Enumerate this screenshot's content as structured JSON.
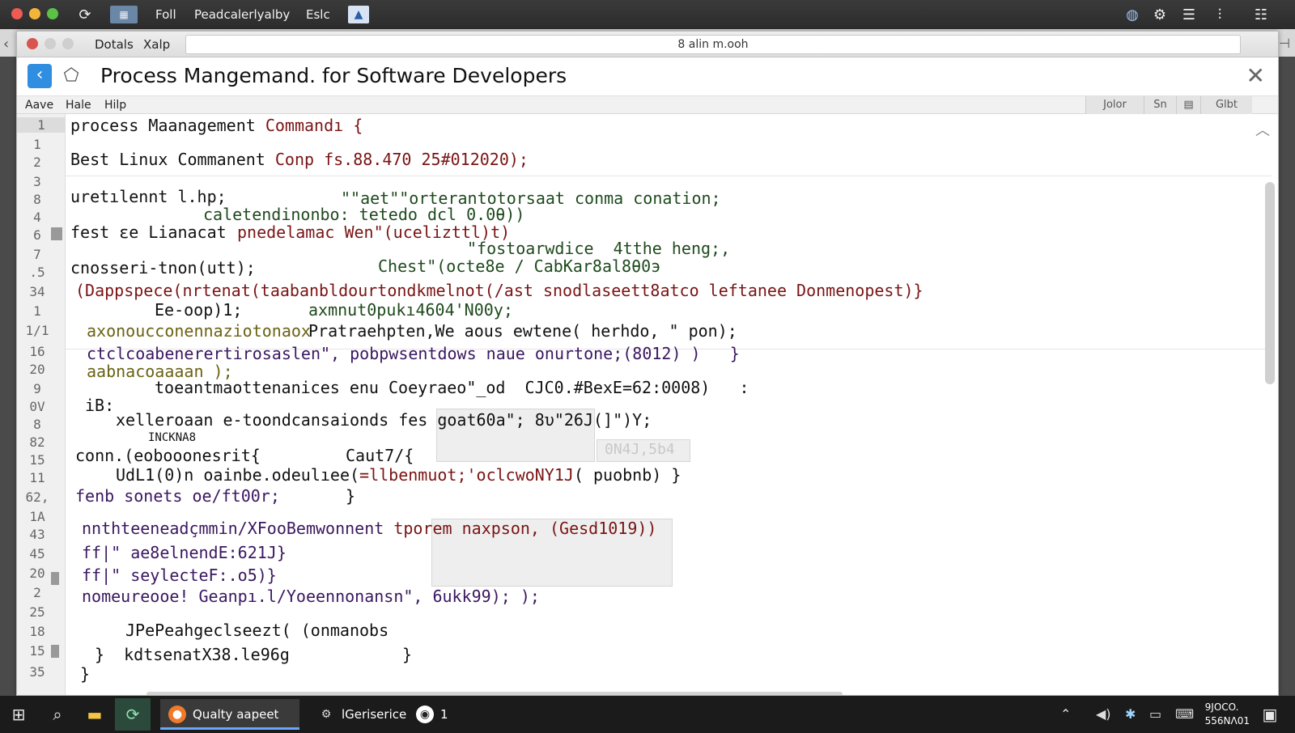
{
  "menubar": {
    "items": [
      "Foll",
      "Peadcalerlyalby",
      "Eslc"
    ]
  },
  "window": {
    "tabs": [
      "Dotals",
      "Xalp"
    ],
    "address": "8 alin m.ooh",
    "title": "Process Mangemand. for Software Developers"
  },
  "app_menu": {
    "items": [
      "Aave",
      "Hale",
      "Hilp"
    ],
    "tools": [
      "Jolor",
      "Sn",
      "Glbt"
    ]
  },
  "editor": {
    "line_numbers": [
      "1",
      "1",
      "2",
      "3",
      "8",
      "4",
      "6",
      "7",
      ".5",
      "34",
      "1",
      "1/1",
      "16",
      "20",
      "9",
      "0V",
      "8",
      "82",
      "15",
      "11",
      "62,",
      "1A",
      "43",
      "45",
      "20",
      "2",
      "25",
      "18",
      "15",
      "35"
    ],
    "lines": [
      {
        "text": "process Maanagement",
        "col2": "Commandı {"
      },
      {
        "text": "Best Linux Commanent",
        "col2": "Conp fs.88.470 25#012020);"
      },
      {
        "text": "uretılennt l.hp;",
        "col2": "\"\"aet\"\"orterantotorsaat conma conation;"
      },
      {
        "text": "caletendinonbo: tetedo dcl 0.0θ))"
      },
      {
        "text": "fest εe Lianacat",
        "col2": "pnedelamac Wen\"(ucelizttl)t)"
      },
      {
        "text": "\"fostoarwdice  4tthe heng;,"
      },
      {
        "text": "cnosseri-tnon(utt);",
        "col2": "Chest\"(octe8e / CabKar8al8θ0э"
      },
      {
        "text": "(Dappspece(nrtenat(taabanbldourtondkmelnot(/ast snodlaseett8atco leftanee Donmenopest)}"
      },
      {
        "text": "Ee-oop)1;",
        "col2": "axmnut0pukı4604'N00y;"
      },
      {
        "text": "axonoucconennaziotonaox",
        "col2": "Pratraehpten,We aous ewtene( herhdo, \" pon);"
      },
      {
        "text": "ctclcoabenerertirosaslen\", pobpwsentdows naue onurtone;(8012) )   }"
      },
      {
        "text": "aabnacoaaaan );"
      },
      {
        "text": "toeantmaottenanices enu Coeyraeo\"_od  CJC0.#BexE=62:0008)   :"
      },
      {
        "text": "iB:"
      },
      {
        "text": "xelleroaan e-toondcansaionds fes goat60a\"; 8υ\"26J(]\")Y;"
      },
      {
        "text": "INCKNA8"
      },
      {
        "text": "conn.(eobooonesrit{",
        "col2": "Caut7/{"
      },
      {
        "text": "UdL1(0)n oainbe.odeulıee(",
        "col2": "=llbenmuot;'oclcwoNY1J",
        "col3": "( puobnb) }"
      },
      {
        "text": "fenb sonets oe/ft00r;",
        "col2": "}"
      },
      {
        "text": "nnthteeneadçmmin/XFooBemwonnent",
        "col2": "tporem naxpson,",
        "col3": "(Gesd1019))"
      },
      {
        "text": "ff|\" ae8elnendE:621J}"
      },
      {
        "text": "ff|\" seylecteF:.o5)}"
      },
      {
        "text": "nomeureooe! Geanpı.l/Yoeennonansn\", 6ukk99); );"
      },
      {
        "text": "JPePeahgeclseezt( (onmanobs"
      },
      {
        "text": "}  kdtsenatX38.le96g",
        "col2": "}"
      },
      {
        "text": "}"
      }
    ],
    "ghost_text": "0N4J,5b4"
  },
  "taskbar": {
    "apps": [
      "Qualty aapeet",
      "lGeriserice",
      "1"
    ],
    "clock_line1": "9JOCO.",
    "clock_line2": "556NΛ01"
  }
}
